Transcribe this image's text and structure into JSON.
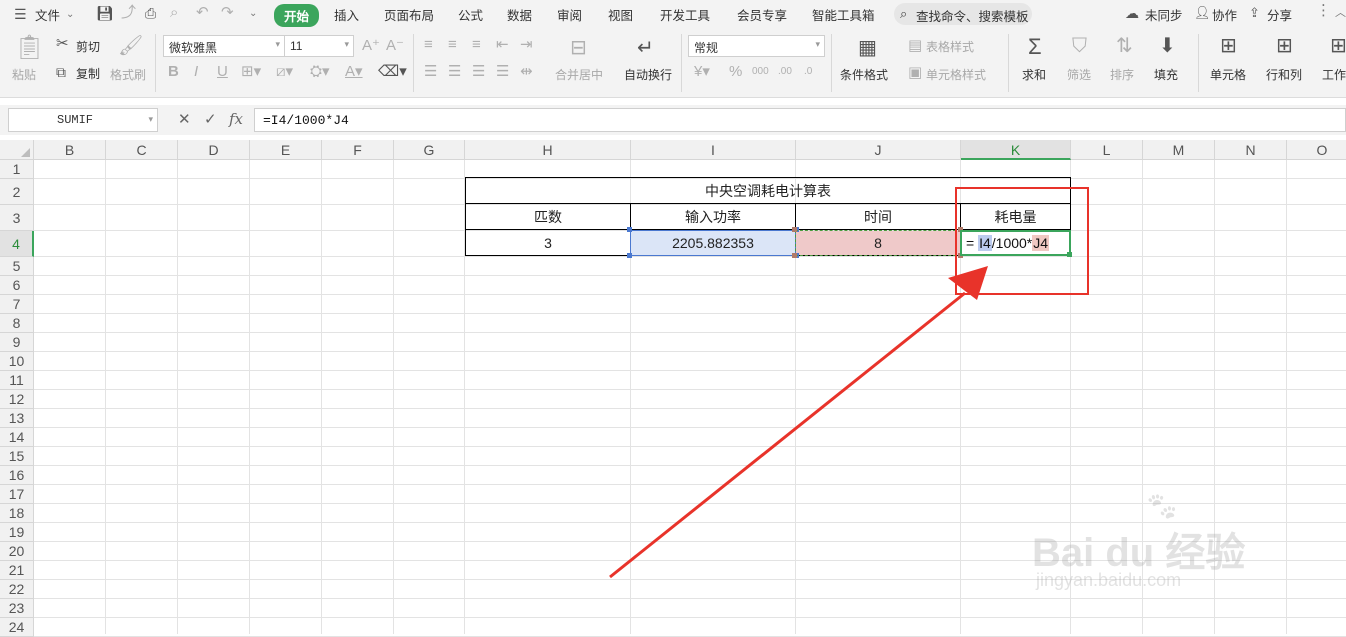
{
  "menubar": {
    "file": "文件",
    "tabs": [
      "开始",
      "插入",
      "页面布局",
      "公式",
      "数据",
      "审阅",
      "视图",
      "开发工具",
      "会员专享",
      "智能工具箱"
    ],
    "search": "查找命令、搜索模板",
    "sync": "未同步",
    "collab": "协作",
    "share": "分享"
  },
  "ribbon": {
    "paste": "粘贴",
    "cut": "剪切",
    "copy": "复制",
    "format_painter": "格式刷",
    "font_name": "微软雅黑",
    "font_size": "11",
    "merge_center": "合并居中",
    "wrap_text": "自动换行",
    "number_format": "常规",
    "cond_format": "条件格式",
    "table_style": "表格样式",
    "cell_style": "单元格样式",
    "sum": "求和",
    "filter": "筛选",
    "sort": "排序",
    "fill": "填充",
    "cell": "单元格",
    "row_col": "行和列",
    "worksheet": "工作"
  },
  "formula_bar": {
    "name_box": "SUMIF",
    "fx": "fx",
    "formula": "=I4/1000*J4"
  },
  "columns": [
    "B",
    "C",
    "D",
    "E",
    "F",
    "G",
    "H",
    "I",
    "J",
    "K",
    "L",
    "M",
    "N",
    "O"
  ],
  "rows": [
    "1",
    "2",
    "3",
    "4",
    "5",
    "6",
    "7",
    "8",
    "9",
    "10",
    "11",
    "12",
    "13",
    "14",
    "15",
    "16",
    "17",
    "18",
    "19",
    "20",
    "21",
    "22",
    "23",
    "24"
  ],
  "table": {
    "title": "中央空调耗电计算表",
    "headers": [
      "匹数",
      "输入功率",
      "时间",
      "耗电量"
    ],
    "row": {
      "h4": "3",
      "i4": "2205.882353",
      "j4": "8",
      "k4_eq": "=",
      "k4_ref1": "I4",
      "k4_mid": "/1000*",
      "k4_ref2": "J4"
    }
  },
  "watermark": {
    "brand": "Bai du 经验",
    "url": "jingyan.baidu.com"
  },
  "colors": {
    "accent_green": "#3ba55c",
    "annotation_red": "#e8332a",
    "i4_fill": "#dbe5f7",
    "j4_fill": "#efc9c9"
  }
}
